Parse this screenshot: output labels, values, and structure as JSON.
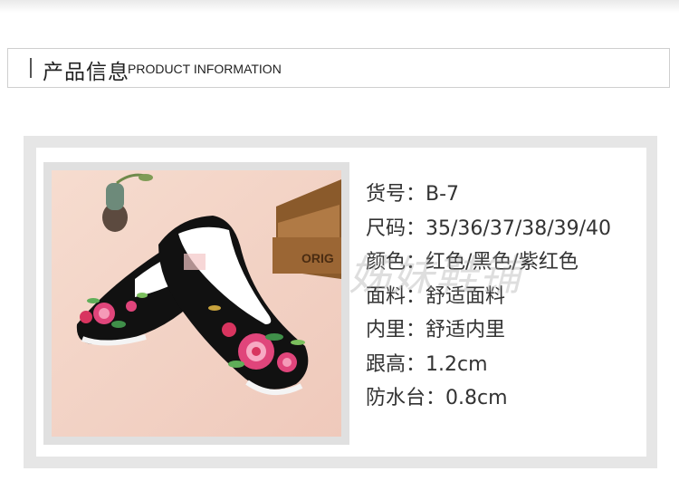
{
  "header": {
    "title_cn": "产品信息",
    "title_en": "PRODUCT INFORMATION"
  },
  "product": {
    "image_icon": "embroidered-shoes-photo",
    "box_text": "ORIG",
    "specs": [
      {
        "label": "货号：",
        "value": "B-7"
      },
      {
        "label": "尺码：",
        "value": "35/36/37/38/39/40"
      },
      {
        "label": "颜色：",
        "value": "红色/黑色/紫红色"
      },
      {
        "label": "面料：",
        "value": "舒适面料"
      },
      {
        "label": "内里：",
        "value": "舒适内里"
      },
      {
        "label": "跟高：",
        "value": "1.2cm"
      },
      {
        "label": "防水台：",
        "value": "0.8cm"
      }
    ]
  },
  "watermark": "姊妹鞋铺",
  "colors": {
    "band": "#e6e6e6",
    "shoe": "#111111",
    "flower": "#e0457b",
    "background": "#f2d4c7"
  }
}
